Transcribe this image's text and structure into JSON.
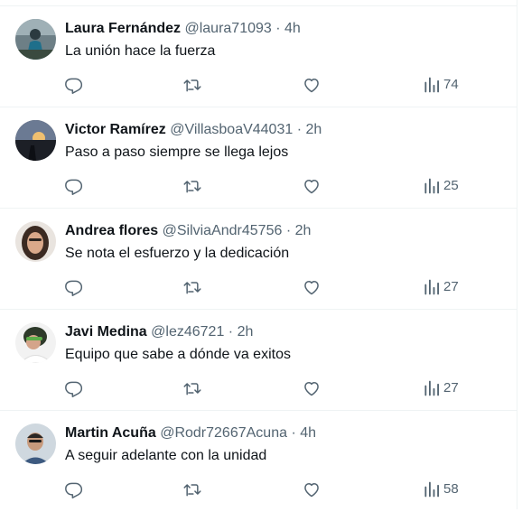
{
  "tweets": [
    {
      "name": "Laura Fernández",
      "handle": "@laura71093",
      "separator": "·",
      "time": "4h",
      "text": "La unión hace la fuerza",
      "views": "74",
      "avatar_icon": "avatar-photo-icon"
    },
    {
      "name": "Victor Ramírez",
      "handle": "@VillasboaV44031",
      "separator": "·",
      "time": "2h",
      "text": "Paso a paso siempre se llega lejos",
      "views": "25",
      "avatar_icon": "avatar-photo-icon"
    },
    {
      "name": "Andrea flores",
      "handle": "@SilviaAndr45756",
      "separator": "·",
      "time": "2h",
      "text": "Se nota el esfuerzo y la dedicación",
      "views": "27",
      "avatar_icon": "avatar-photo-icon"
    },
    {
      "name": "Javi Medina",
      "handle": "@lez46721",
      "separator": "·",
      "time": "2h",
      "text": "Equipo que sabe a dónde va exitos",
      "views": "27",
      "avatar_icon": "avatar-photo-icon"
    },
    {
      "name": "Martin Acuña",
      "handle": "@Rodr72667Acuna",
      "separator": "·",
      "time": "4h",
      "text": "A seguir adelante con la unidad",
      "views": "58",
      "avatar_icon": "avatar-photo-icon"
    }
  ],
  "icons": {
    "reply": "reply-icon",
    "retweet": "retweet-icon",
    "like": "like-icon",
    "views": "views-icon"
  },
  "colors": {
    "text_primary": "#0f1419",
    "text_secondary": "#536471",
    "divider": "#eff3f4"
  }
}
